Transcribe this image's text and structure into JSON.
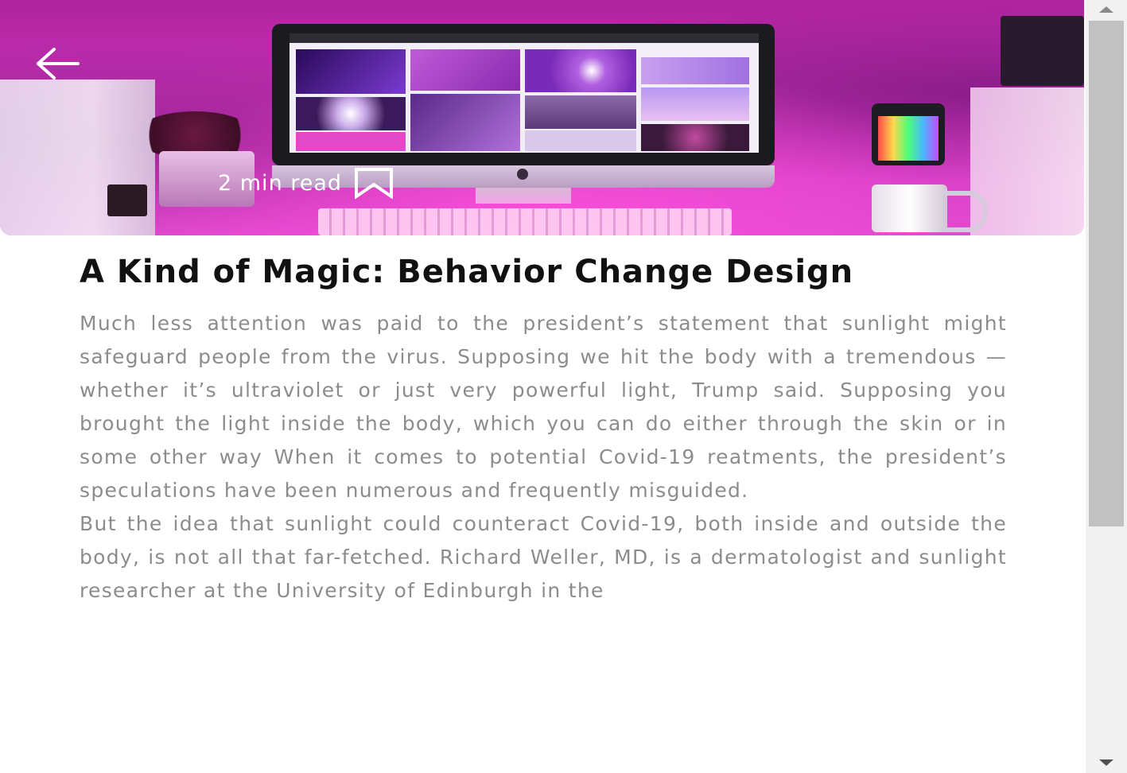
{
  "hero": {
    "image_description": "",
    "read_time": "2 min read"
  },
  "icons": {
    "back": "arrow-left-icon",
    "bookmark": "bookmark-icon"
  },
  "article": {
    "title": "A Kind of Magic: Behavior Change Design",
    "paragraphs": [
      "Much less attention was paid to the president’s statement that sunlight might safeguard people from the virus. Supposing we hit the body with a tremendous — whether it’s ultraviolet or just very powerful light, Trump said. Supposing you brought the light inside the body, which you can do either through the skin or in some other way When it comes to potential Covid-19 reatments, the president’s speculations have been numerous and frequently misguided.",
      "But the idea that sunlight could counteract Covid-19, both inside and outside the body, is not all that far-fetched. Richard Weller, MD, is a dermatologist and sunlight researcher at the University of Edinburgh in the"
    ]
  },
  "colors": {
    "title": "#111111",
    "body_text": "#8c8c8c",
    "hero_tint": "#c02fb0"
  }
}
